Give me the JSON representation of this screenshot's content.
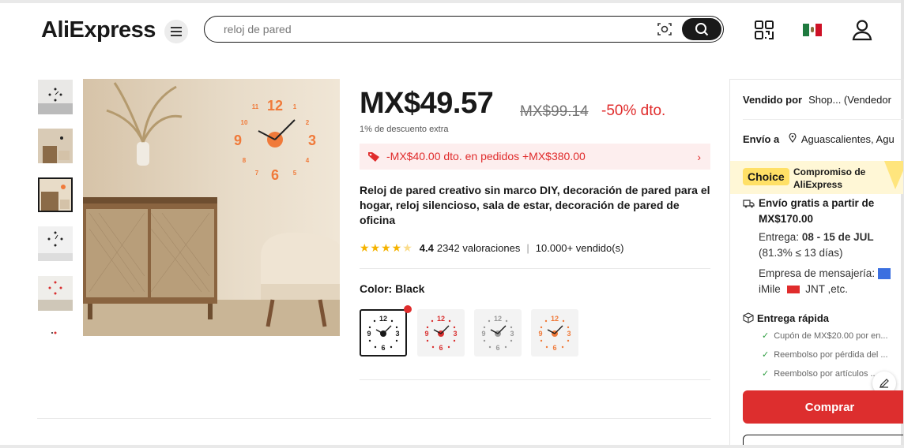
{
  "header": {
    "logo": "AliExpress",
    "search_value": "reloj de pared",
    "icons": [
      "menu-icon",
      "camera-search-icon",
      "search-icon",
      "qr-code-icon",
      "mexico-flag-icon",
      "user-icon"
    ]
  },
  "product": {
    "price": "MX$49.57",
    "old_price": "MX$99.14",
    "discount": "-50% dto.",
    "extra_discount": "1% de descuento extra",
    "coupon_text": "-MX$40.00 dto. en pedidos +MX$380.00",
    "title": "Reloj de pared creativo sin marco DIY, decoración de pared para el hogar, reloj silencioso, sala de estar, decoración de pared de oficina",
    "rating_value": "4.4",
    "rating_stars": 4.4,
    "reviews": "2342 valoraciones",
    "sold": "10.000+ vendido(s)",
    "color_label": "Color: Black",
    "swatches": [
      {
        "name": "Black",
        "hand_color": "#191919"
      },
      {
        "name": "Red",
        "hand_color": "#d93030"
      },
      {
        "name": "Silver",
        "hand_color": "#9a9a9a"
      },
      {
        "name": "Orange",
        "hand_color": "#f07a3a"
      }
    ]
  },
  "panel": {
    "sold_by_label": "Vendido por",
    "sold_by_value": "Shop... (Vendedor",
    "ship_to_label": "Envío a",
    "ship_to_value": "Aguascalientes, Agu",
    "choice_badge": "Choice",
    "choice_text": "Compromiso de AliExpress",
    "free_ship": "Envío gratis a partir de MX$170.00",
    "delivery_label": "Entrega:",
    "delivery_dates": "08 - 15 de JUL",
    "delivery_pct": "(81.3% ≤ 13 días)",
    "courier_label": "Empresa de mensajería:",
    "courier_value": "iMile",
    "courier_value2": "JNT ,etc.",
    "fast_label": "Entrega rápida",
    "benefits": [
      "Cupón de MX$20.00 por en...",
      "Reembolso por pérdida del ...",
      "Reembolso por artículos ..."
    ],
    "buy_label": "Comprar"
  },
  "colors": {
    "accent_red": "#e02c2c",
    "buy_red": "#dd2e2e",
    "choice_yellow": "#ffe066",
    "clock_orange": "#f07a3a"
  }
}
